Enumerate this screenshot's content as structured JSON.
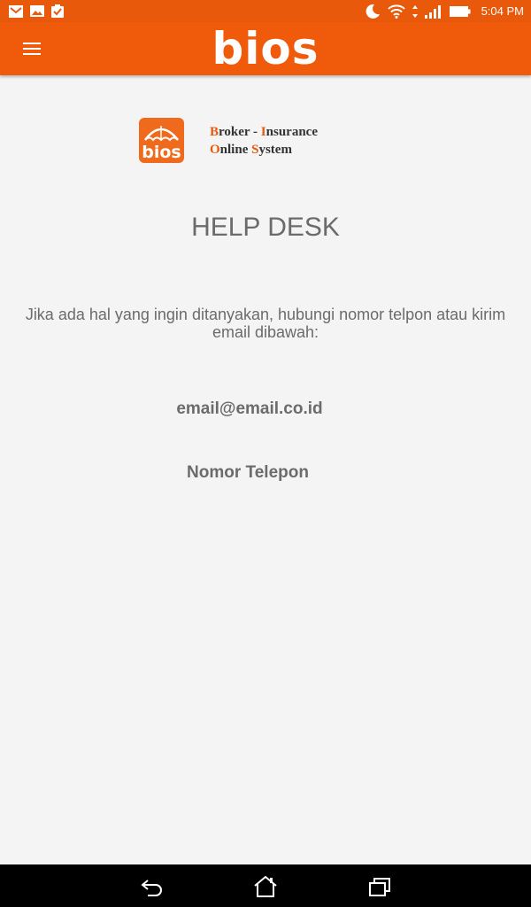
{
  "status_bar": {
    "time": "5:04 PM",
    "left_icons": [
      "gmail-icon",
      "image-notification-icon",
      "clipboard-check-icon"
    ],
    "right_icons": [
      "moon-icon",
      "wifi-icon",
      "data-arrows-icon",
      "signal-icon",
      "battery-icon"
    ]
  },
  "app_bar": {
    "logo_text": "bios",
    "menu_icon": "hamburger-menu-icon",
    "color": "#ef5a0b"
  },
  "brand": {
    "logo_text": "bios",
    "tagline": {
      "line1": [
        {
          "text": "B",
          "highlight": true
        },
        {
          "text": "roker - ",
          "highlight": false
        },
        {
          "text": "I",
          "highlight": true
        },
        {
          "text": "nsurance",
          "highlight": false
        }
      ],
      "line2": [
        {
          "text": "O",
          "highlight": true
        },
        {
          "text": "nline ",
          "highlight": false
        },
        {
          "text": "S",
          "highlight": true
        },
        {
          "text": "ystem",
          "highlight": false
        }
      ]
    },
    "accent_color": "#e8590c"
  },
  "main": {
    "title": "HELP DESK",
    "description": "Jika ada hal yang ingin ditanyakan, hubungi nomor telpon atau kirim email dibawah:",
    "email": "email@email.co.id",
    "phone": "Nomor Telepon"
  },
  "nav_bar": {
    "buttons": [
      "back-icon",
      "home-icon",
      "recent-apps-icon"
    ]
  }
}
